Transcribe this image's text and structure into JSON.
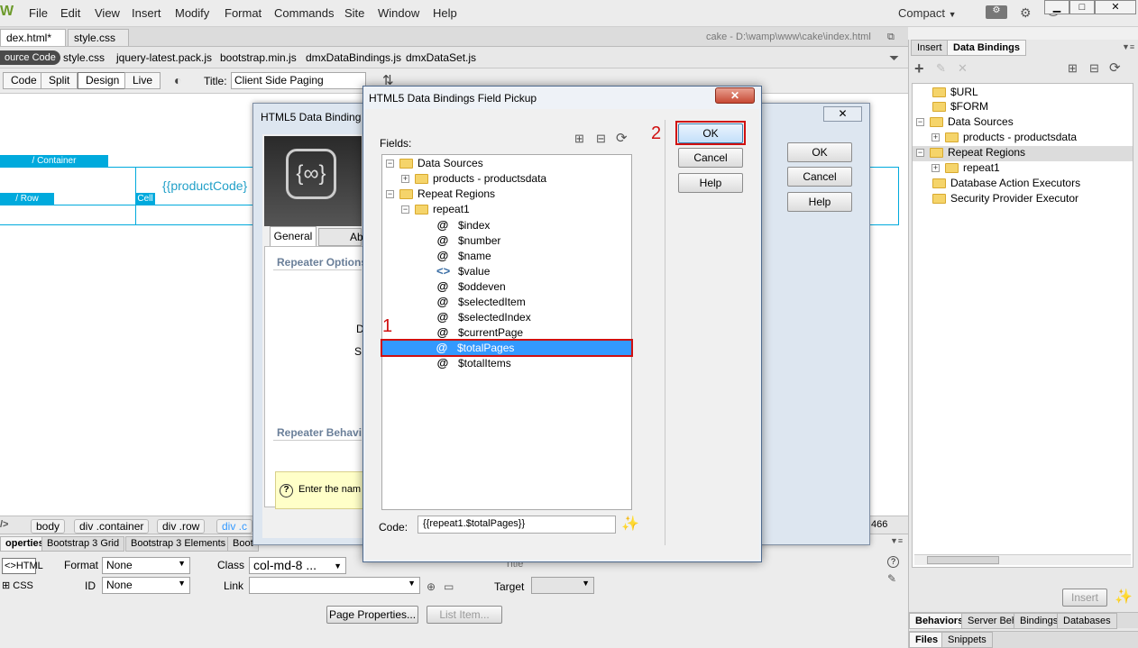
{
  "app": {
    "menu": [
      "File",
      "Edit",
      "View",
      "Insert",
      "Modify",
      "Format",
      "Commands",
      "Site",
      "Window",
      "Help"
    ],
    "workspace": "Compact"
  },
  "doc_tabs": [
    {
      "label": "dex.html*",
      "active": true
    },
    {
      "label": "style.css",
      "active": false
    }
  ],
  "doc_path": "cake - D:\\wamp\\www\\cake\\index.html",
  "related_files": [
    "ource Code",
    "style.css",
    "jquery-latest.pack.js",
    "bootstrap.min.js",
    "dmxDataBindings.js",
    "dmxDataSet.js"
  ],
  "view_bar": {
    "buttons": [
      "Code",
      "Split",
      "Design",
      "Live"
    ],
    "active": "Design",
    "title_label": "Title:",
    "title_value": "Client Side Paging"
  },
  "design": {
    "container_label": "/ Container",
    "row_label": "/ Row",
    "cell_label": "Cell",
    "binding_text": "{{productCode}"
  },
  "right_panel": {
    "tabs": [
      "Insert",
      "Data Bindings"
    ],
    "active_tab": "Data Bindings",
    "tree": [
      {
        "label": "$URL",
        "level": 0,
        "expander": ""
      },
      {
        "label": "$FORM",
        "level": 0,
        "expander": ""
      },
      {
        "label": "Data Sources",
        "level": 0,
        "expander": "−"
      },
      {
        "label": "products - productsdata",
        "level": 1,
        "expander": "+"
      },
      {
        "label": "Repeat Regions",
        "level": 0,
        "expander": "−"
      },
      {
        "label": "repeat1",
        "level": 1,
        "expander": "+"
      },
      {
        "label": "Database Action Executors",
        "level": 0,
        "expander": ""
      },
      {
        "label": "Security Provider Executor",
        "level": 0,
        "expander": ""
      }
    ],
    "insert_button": "Insert",
    "bottom_tabs": [
      "Behaviors",
      "Server Beh",
      "Bindings",
      "Databases"
    ],
    "bottom_tabs2": [
      "Files",
      "Snippets"
    ]
  },
  "tag_bar": [
    "body",
    "div .container",
    "div .row",
    "div .c"
  ],
  "tag_bar_right": "466",
  "props": {
    "tabs": [
      "operties",
      "Bootstrap 3 Grid",
      "Bootstrap 3 Elements",
      "Boot"
    ],
    "html_label": "HTML",
    "css_label": "CSS",
    "format_label": "Format",
    "format_value": "None",
    "id_label": "ID",
    "id_value": "None",
    "class_label": "Class",
    "class_value": "col-md-8 ...",
    "link_label": "Link",
    "target_label": "Target",
    "title_label": "Title",
    "page_properties": "Page Properties...",
    "list_item": "List Item..."
  },
  "back_dialog": {
    "title": "HTML5 Data Binding",
    "tabs": [
      "General",
      "Ab"
    ],
    "section1": "Repeater Options",
    "section2": "Repeater Behavi",
    "letter_d": "D",
    "letter_s": "S",
    "help_text": "Enter the nam",
    "buttons": [
      "OK",
      "Cancel",
      "Help"
    ]
  },
  "front_dialog": {
    "title": "HTML5 Data Bindings Field Pickup",
    "fields_label": "Fields:",
    "tree": [
      {
        "label": "Data Sources",
        "level": 0,
        "expander": "−",
        "icon": "folder"
      },
      {
        "label": "products - productsdata",
        "level": 1,
        "expander": "+",
        "icon": "folder"
      },
      {
        "label": "Repeat Regions",
        "level": 0,
        "expander": "−",
        "icon": "folder"
      },
      {
        "label": "repeat1",
        "level": 1,
        "expander": "−",
        "icon": "folder"
      },
      {
        "label": "$index",
        "level": 2,
        "icon": "@"
      },
      {
        "label": "$number",
        "level": 2,
        "icon": "@"
      },
      {
        "label": "$name",
        "level": 2,
        "icon": "@"
      },
      {
        "label": "$value",
        "level": 2,
        "icon": "<>"
      },
      {
        "label": "$oddeven",
        "level": 2,
        "icon": "@"
      },
      {
        "label": "$selectedItem",
        "level": 2,
        "icon": "@"
      },
      {
        "label": "$selectedIndex",
        "level": 2,
        "icon": "@"
      },
      {
        "label": "$currentPage",
        "level": 2,
        "icon": "@"
      },
      {
        "label": "$totalPages",
        "level": 2,
        "icon": "@",
        "selected": true
      },
      {
        "label": "$totalItems",
        "level": 2,
        "icon": "@"
      }
    ],
    "buttons": [
      "OK",
      "Cancel",
      "Help"
    ],
    "code_label": "Code:",
    "code_value": "{{repeat1.$totalPages}}"
  },
  "annotations": {
    "step1": "1",
    "step2": "2"
  },
  "colors": {
    "accent": "#0078d7",
    "selection": "#3399ff",
    "annotation": "#d01010",
    "design_guide": "#00aadd"
  }
}
